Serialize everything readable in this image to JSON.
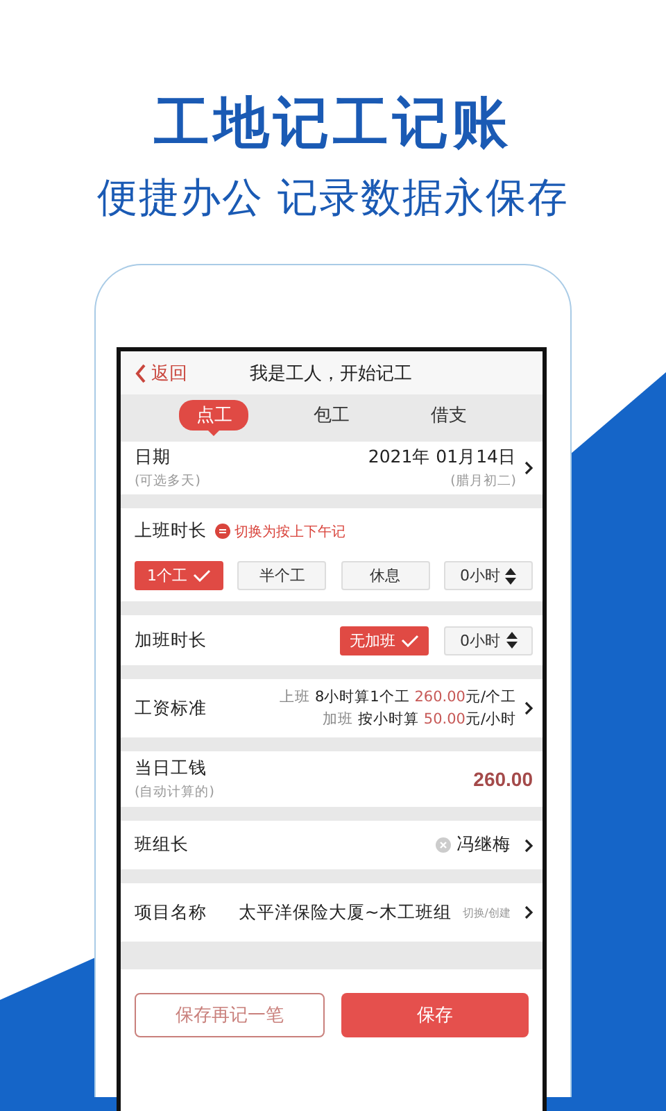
{
  "headline": "工地记工记账",
  "subheadline": "便捷办公 记录数据永保存",
  "app": {
    "nav": {
      "back": "返回",
      "title": "我是工人，开始记工"
    },
    "tabs": [
      {
        "label": "点工",
        "selected": true
      },
      {
        "label": "包工",
        "selected": false
      },
      {
        "label": "借支",
        "selected": false
      }
    ],
    "date": {
      "label": "日期",
      "hint": "(可选多天)",
      "value": "2021年 01月14日",
      "lunar": "(腊月初二)"
    },
    "work_duration": {
      "label": "上班时长",
      "switch_link": "切换为按上下午记",
      "options": [
        {
          "kind": "option",
          "label": "1个工",
          "selected": true
        },
        {
          "kind": "option",
          "label": "半个工",
          "selected": false
        },
        {
          "kind": "option",
          "label": "休息",
          "selected": false
        },
        {
          "kind": "stepper",
          "label": "0小时",
          "selected": false
        }
      ]
    },
    "overtime": {
      "label": "加班时长",
      "options": [
        {
          "kind": "option",
          "label": "无加班",
          "selected": true
        },
        {
          "kind": "stepper",
          "label": "0小时",
          "selected": false
        }
      ]
    },
    "wage": {
      "label": "工资标准",
      "lines": [
        {
          "type": "上班",
          "rule": "8小时算1个工",
          "amount": "260.00",
          "unit": "元/个工"
        },
        {
          "type": "加班",
          "rule": "按小时算",
          "amount": "50.00",
          "unit": "元/小时"
        }
      ]
    },
    "daily_pay": {
      "label": "当日工钱",
      "hint": "(自动计算的)",
      "amount": "260.00"
    },
    "leader": {
      "label": "班组长",
      "value": "冯继梅"
    },
    "project": {
      "label": "项目名称",
      "value": "太平洋保险大厦~木工班组",
      "action": "切换/创建"
    },
    "buttons": [
      {
        "kind": "secondary",
        "label": "保存再记一笔"
      },
      {
        "kind": "primary",
        "label": "保存"
      }
    ]
  }
}
